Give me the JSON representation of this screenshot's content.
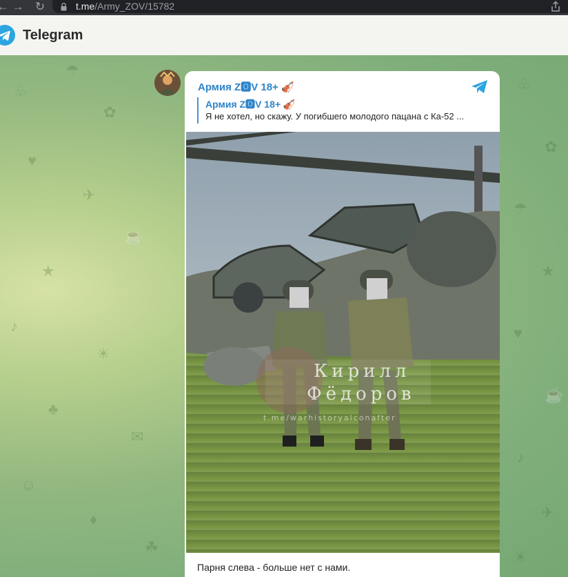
{
  "browser": {
    "url_host": "t.me",
    "url_path": "/Army_ZOV/15782"
  },
  "header": {
    "title": "Telegram"
  },
  "message": {
    "channel_name": "Армия Z🅾V 18+ 🎻",
    "forwarded_from": "Армия Z🅾V 18+ 🎻",
    "forwarded_preview": "Я не хотел, но скажу. У погибшего молодого пацана с Ка-52 ...",
    "caption": "Парня слева - больше нет с нами."
  },
  "photo": {
    "watermark_line1": "Кирилл",
    "watermark_line2": "Фёдоров",
    "watermark_link": "t.me/warhistoryalconafter"
  },
  "colors": {
    "link": "#2f84c8",
    "telegram_blue": "#2ca5e0",
    "header_bg": "#f4f5f0"
  }
}
